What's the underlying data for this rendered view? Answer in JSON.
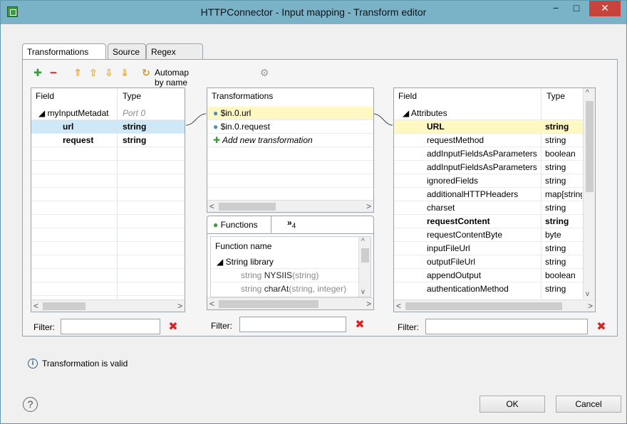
{
  "window": {
    "title": "HTTPConnector - Input mapping - Transform editor",
    "minimize": "−",
    "maximize": "□",
    "close": "✕"
  },
  "tabs": [
    {
      "label": "Transformations"
    },
    {
      "label": "Source"
    },
    {
      "label": "Regex tester"
    }
  ],
  "toolbar": {
    "automap_label": "Automap by name"
  },
  "input_table": {
    "headers": {
      "field": "Field",
      "type": "Type"
    },
    "rows": [
      {
        "field": "◢ myInputMetadat",
        "type": "Port 0"
      },
      {
        "field": "url",
        "type": "string"
      },
      {
        "field": "request",
        "type": "string"
      }
    ]
  },
  "transformations": {
    "header": "Transformations",
    "items": [
      {
        "label": "$in.0.url"
      },
      {
        "label": "$in.0.request"
      }
    ],
    "add_label": "Add new transformation"
  },
  "functions": {
    "tab_label": "Functions",
    "overflow_label": "»",
    "overflow_count": "4",
    "header": "Function name",
    "library": "◢ String library",
    "items": [
      {
        "ret": "string ",
        "name": "NYSIIS",
        "args": "(string)"
      },
      {
        "ret": "string ",
        "name": "charAt",
        "args": "(string, integer)"
      }
    ]
  },
  "output_table": {
    "headers": {
      "field": "Field",
      "type": "Type"
    },
    "group": "◢ Attributes",
    "rows": [
      {
        "field": "URL",
        "type": "string"
      },
      {
        "field": "requestMethod",
        "type": "string"
      },
      {
        "field": "addInputFieldsAsParameters",
        "type": "boolean"
      },
      {
        "field": "addInputFieldsAsParameters",
        "type": "string"
      },
      {
        "field": "ignoredFields",
        "type": "string"
      },
      {
        "field": "additionalHTTPHeaders",
        "type": "map[string, s"
      },
      {
        "field": "charset",
        "type": "string"
      },
      {
        "field": "requestContent",
        "type": "string"
      },
      {
        "field": "requestContentByte",
        "type": "byte"
      },
      {
        "field": "inputFileUrl",
        "type": "string"
      },
      {
        "field": "outputFileUrl",
        "type": "string"
      },
      {
        "field": "appendOutput",
        "type": "boolean"
      },
      {
        "field": "authenticationMethod",
        "type": "string"
      }
    ]
  },
  "filter": {
    "label": "Filter:",
    "value": ""
  },
  "status": {
    "message": "Transformation is valid"
  },
  "buttons": {
    "ok": "OK",
    "cancel": "Cancel",
    "help": "?"
  },
  "colors": {
    "titlebar": "#7ab3c8",
    "selection": "#cfe8f7",
    "highlight": "#fff8c2",
    "close": "#c7443c"
  }
}
